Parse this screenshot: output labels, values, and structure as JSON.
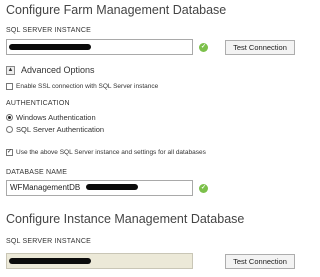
{
  "farm_section": {
    "title": "Configure Farm Management Database",
    "sql_server_label": "SQL SERVER INSTANCE",
    "sql_server_value": "",
    "test_connection_label": "Test Connection",
    "advanced_options_label": "Advanced Options",
    "enable_ssl_label": "Enable SSL connection with SQL Server instance",
    "authentication_label": "AUTHENTICATION",
    "auth_windows_label": "Windows Authentication",
    "auth_sql_label": "SQL Server Authentication",
    "use_above_label": "Use the above SQL Server instance and settings for all databases",
    "database_name_label": "DATABASE NAME",
    "database_name_value": "WFManagementDB"
  },
  "instance_section": {
    "title": "Configure Instance Management Database",
    "sql_server_label": "SQL SERVER INSTANCE",
    "test_connection_label": "Test Connection"
  },
  "icons": {
    "valid": "check-circle-icon",
    "expander": "chevron-up-icon"
  },
  "colors": {
    "valid_green": "#7cc04b",
    "disabled_input": "#ece9d8"
  },
  "state": {
    "enable_ssl_checked": false,
    "auth_selected": "Windows Authentication",
    "use_above_checked": true
  }
}
